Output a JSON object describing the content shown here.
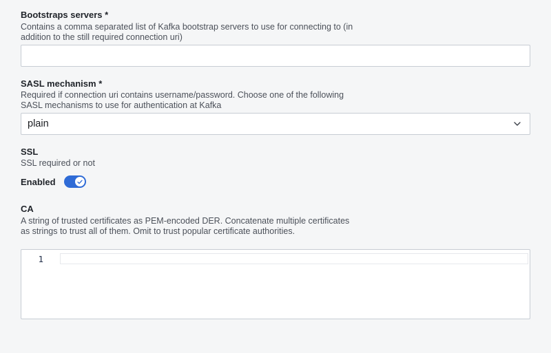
{
  "bootstrap": {
    "label": "Bootstraps servers *",
    "description": "Contains a comma separated list of Kafka bootstrap servers to use for connecting to (in addition to the still required connection uri)",
    "value": ""
  },
  "sasl": {
    "label": "SASL mechanism *",
    "description": "Required if connection uri contains username/password. Choose one of the following SASL mechanisms to use for authentication at Kafka",
    "selected": "plain",
    "chevron_icon": "chevron-down-icon"
  },
  "ssl": {
    "label": "SSL",
    "description": "SSL required or not",
    "toggle_label": "Enabled",
    "enabled": true,
    "toggle_color": "#2f6bd6",
    "check_icon": "check-icon"
  },
  "ca": {
    "label": "CA",
    "description": "A string of trusted certificates as PEM-encoded DER. Concatenate multiple certificates as strings to trust all of them. Omit to trust popular certificate authorities.",
    "line_numbers": [
      "1"
    ],
    "value": ""
  }
}
